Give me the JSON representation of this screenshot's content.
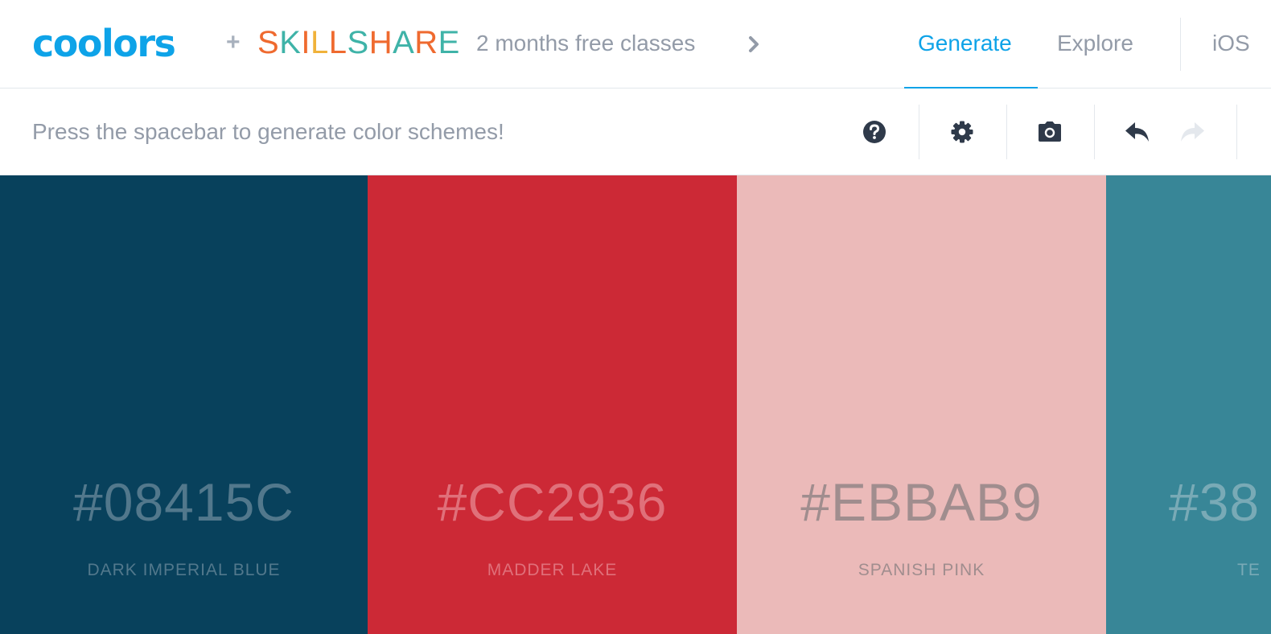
{
  "header": {
    "logo": "coolors",
    "plus": "+",
    "partner_letters": [
      "S",
      "K",
      "I",
      "L",
      "L",
      "S",
      "H",
      "A",
      "R",
      "E"
    ],
    "partner_colors": [
      "#ef6a2f",
      "#3fb3a8",
      "#ef6a2f",
      "#f0b23a",
      "#ef6a2f",
      "#3fb3a8",
      "#ef6a2f",
      "#3fb3a8",
      "#ef6a2f",
      "#3fb3a8"
    ],
    "promo": "2 months free classes",
    "promo_icon": "chevron-right-icon",
    "nav": {
      "generate": "Generate",
      "explore": "Explore",
      "ios": "iOS"
    },
    "active_tab": "Generate",
    "accent": "#0ea3e8"
  },
  "toolbar": {
    "hint": "Press the spacebar to generate color schemes!",
    "icons": [
      "help-icon",
      "settings-icon",
      "camera-icon",
      "undo-icon",
      "redo-icon"
    ]
  },
  "palette": [
    {
      "hex": "#08415C",
      "name": "DARK IMPERIAL BLUE",
      "bg": "#08415c",
      "text_color": "#52788c"
    },
    {
      "hex": "#CC2936",
      "name": "MADDER LAKE",
      "bg": "#cc2936",
      "text_color": "#e0707a"
    },
    {
      "hex": "#EBBAB9",
      "name": "SPANISH PINK",
      "bg": "#ebbab9",
      "text_color": "#a08d8e"
    },
    {
      "hex": "#38",
      "name": "TE",
      "bg": "#388697",
      "text_color": "#79aab6"
    }
  ]
}
